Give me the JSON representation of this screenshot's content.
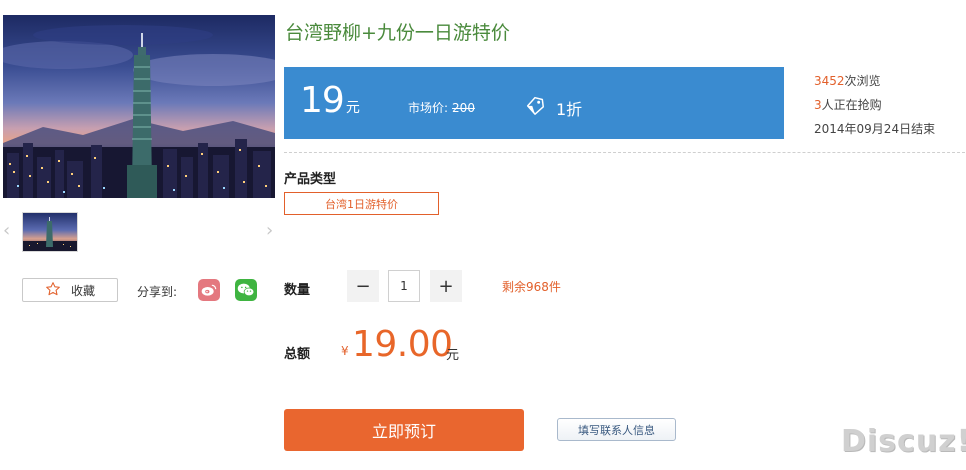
{
  "product": {
    "title": "台湾野柳+九份一日游特价",
    "main_image": "taipei-101-night-skyline",
    "thumbnail": "taipei-101-thumbnail"
  },
  "gallery": {
    "prev_arrow": "‹",
    "next_arrow": "›"
  },
  "actions": {
    "favorite_label": "收藏",
    "share_label": "分享到:",
    "share_targets": [
      "weibo-icon",
      "wechat-icon"
    ]
  },
  "price": {
    "current": "19",
    "current_unit": "元",
    "market_label": "市场价:",
    "market_value": "200",
    "discount": "1折"
  },
  "stats": {
    "views_count": "3452",
    "views_label": "次浏览",
    "buyers_count": "3",
    "buyers_label": "人正在抢购",
    "end_text": "2014年09月24日结束"
  },
  "type_section": {
    "label": "产品类型",
    "selected": "台湾1日游特价"
  },
  "quantity": {
    "label": "数量",
    "minus": "−",
    "value": "1",
    "plus": "+",
    "stock": "剩余968件"
  },
  "total": {
    "label": "总额",
    "currency": "¥",
    "value": "19.00",
    "unit": "元"
  },
  "buttons": {
    "book": "立即预订",
    "contact": "填写联系人信息"
  },
  "watermark": "Discuz!",
  "colors": {
    "accent_orange": "#e9662f",
    "price_bar_blue": "#3a8bd0",
    "title_green": "#4a8a3c"
  }
}
